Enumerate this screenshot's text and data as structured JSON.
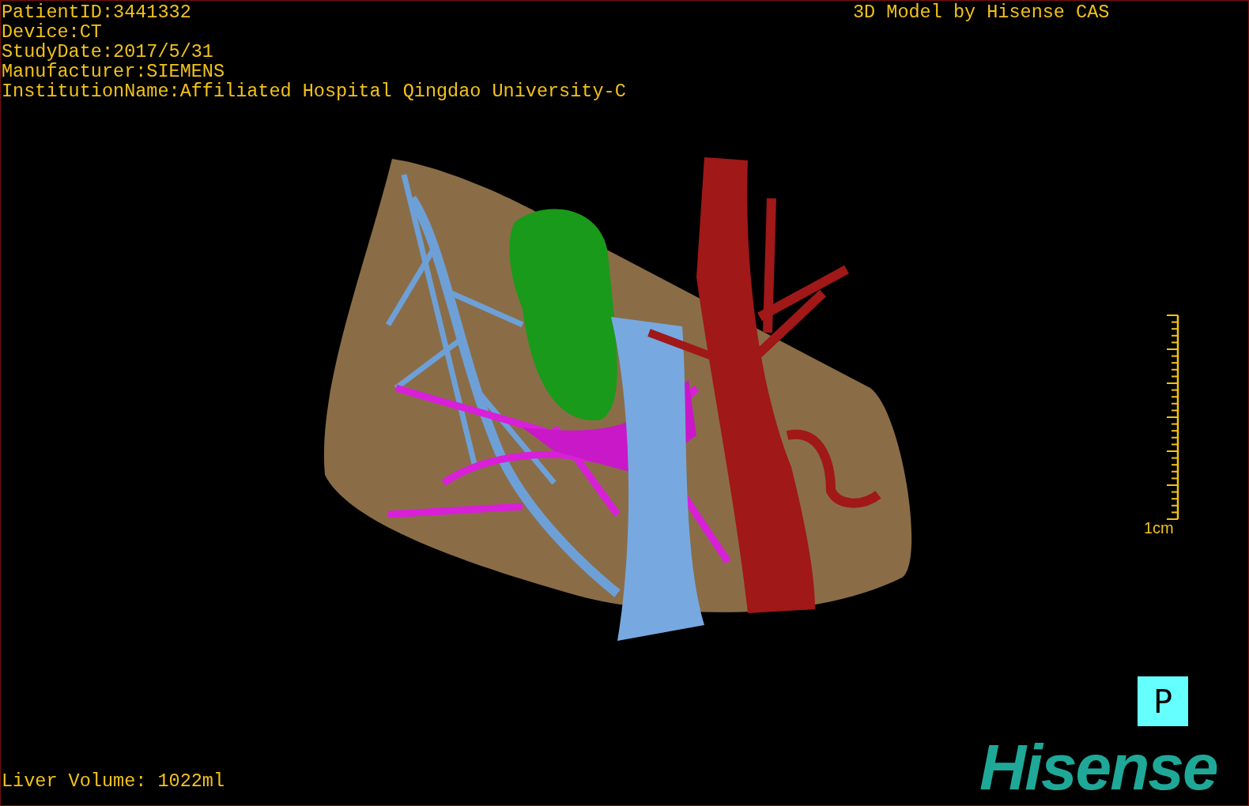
{
  "patient_info": [
    "PatientID:3441332",
    "Device:CT",
    "StudyDate:2017/5/31",
    "Manufacturer:SIEMENS",
    "InstitutionName:Affiliated Hospital Qingdao University-C"
  ],
  "model_credit": "3D Model by Hisense CAS",
  "scale_bar": {
    "label": "1cm"
  },
  "orientation_marker": "P",
  "liver_volume": "Liver Volume: 1022ml",
  "logo": "Hisense"
}
